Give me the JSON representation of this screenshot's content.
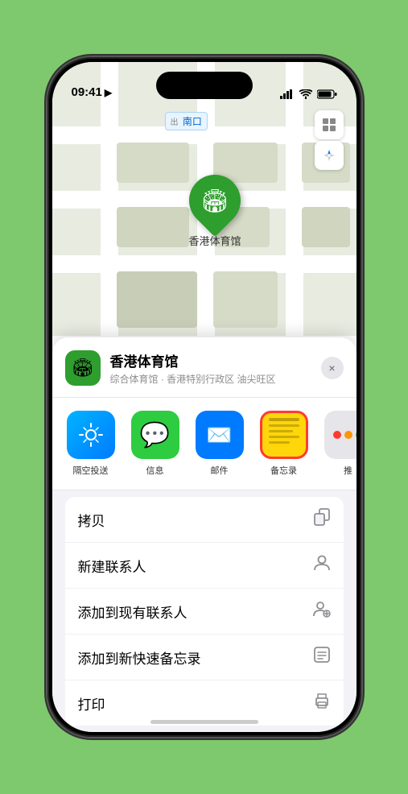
{
  "statusBar": {
    "time": "09:41",
    "locationIcon": "▶"
  },
  "map": {
    "label": "南口",
    "labelPrefix": "出口"
  },
  "pin": {
    "label": "香港体育馆"
  },
  "locationHeader": {
    "name": "香港体育馆",
    "description": "综合体育馆 · 香港特别行政区 油尖旺区",
    "closeLabel": "×"
  },
  "shareItems": [
    {
      "id": "airdrop",
      "label": "隔空投送"
    },
    {
      "id": "messages",
      "label": "信息"
    },
    {
      "id": "mail",
      "label": "邮件"
    },
    {
      "id": "notes",
      "label": "备忘录"
    },
    {
      "id": "more",
      "label": "推"
    }
  ],
  "actionItems": [
    {
      "label": "拷贝",
      "icon": "copy"
    },
    {
      "label": "新建联系人",
      "icon": "person"
    },
    {
      "label": "添加到现有联系人",
      "icon": "person-add"
    },
    {
      "label": "添加到新快速备忘录",
      "icon": "memo"
    },
    {
      "label": "打印",
      "icon": "print"
    }
  ]
}
